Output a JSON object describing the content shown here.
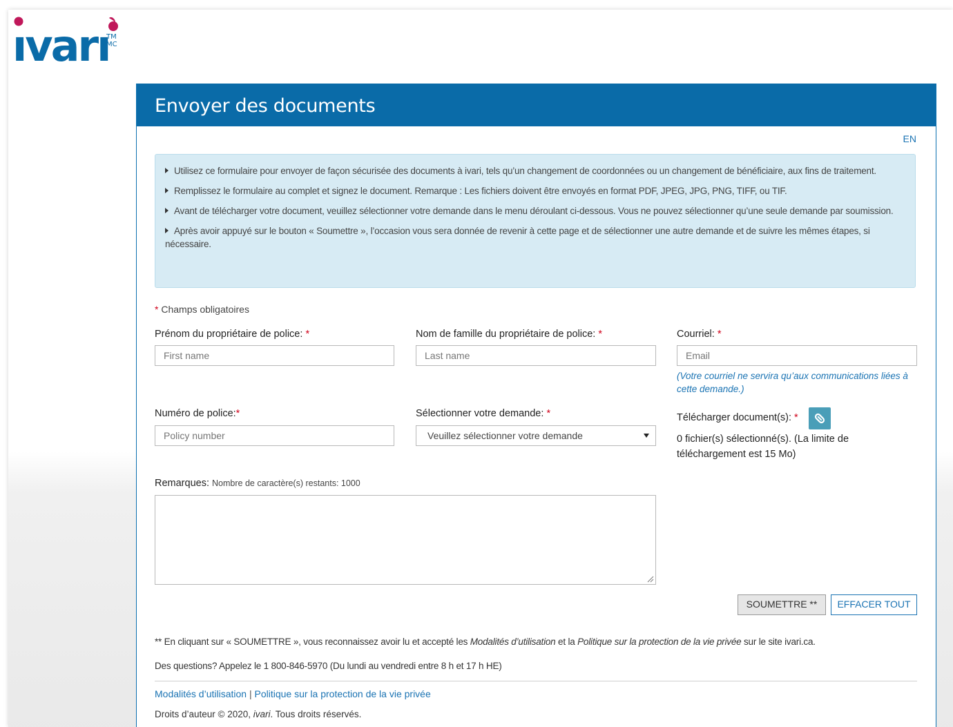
{
  "brand": {
    "logo_text": "ivari",
    "logo_mark": "TM MC",
    "logo_color": "#0a6ba8",
    "accent_color": "#c0185a"
  },
  "header": {
    "title": "Envoyer des documents",
    "lang_link": "EN"
  },
  "info": {
    "items": [
      "Utilisez ce formulaire pour envoyer de façon sécurisée des documents à ivari, tels qu’un changement de coordonnées ou un changement de bénéficiaire, aux fins de traitement.",
      "Remplissez le formulaire au complet et signez le document. Remarque : Les fichiers doivent être envoyés en format PDF, JPEG, JPG, PNG, TIFF, ou TIF.",
      "Avant de télécharger votre document, veuillez sélectionner votre demande dans le menu déroulant ci-dessous. Vous ne pouvez sélectionner qu’une seule demande par soumission.",
      "Après avoir appuyé sur le bouton « Soumettre », l’occasion vous sera donnée de revenir à cette page et de sélectionner une autre demande et de suivre les mêmes étapes, si nécessaire."
    ]
  },
  "form": {
    "required_marker": "*",
    "required_note": "Champs obligatoires",
    "first_name": {
      "label": "Prénom du propriétaire de police:",
      "placeholder": "First name",
      "value": ""
    },
    "last_name": {
      "label": "Nom de famille du propriétaire de police:",
      "placeholder": "Last name",
      "value": ""
    },
    "email": {
      "label": "Courriel:",
      "placeholder": "Email",
      "value": "",
      "hint": "(Votre courriel ne servira qu’aux communications liées à cette demande.)"
    },
    "policy": {
      "label": "Numéro de police:",
      "placeholder": "Policy number",
      "value": ""
    },
    "request": {
      "label": "Sélectionner votre demande:",
      "selected": "Veuillez sélectionner votre demande"
    },
    "upload": {
      "label": "Télécharger document(s):",
      "status": "0 fichier(s) sélectionné(s). (La limite de téléchargement est 15 Mo)",
      "icon": "paperclip-icon"
    },
    "remarks": {
      "label": "Remarques:",
      "counter": "Nombre de caractère(s) restants: 1000",
      "value": ""
    },
    "submit_label": "SOUMETTRE **",
    "clear_label": "EFFACER TOUT"
  },
  "footer": {
    "note_prefix": "** En cliquant sur « SOUMETTRE », vous reconnaissez avoir lu et accepté les ",
    "note_terms": "Modalités d’utilisation",
    "note_mid": " et la ",
    "note_privacy": "Politique sur la protection de la vie privée",
    "note_suffix": " sur le site ivari.ca.",
    "phone": "Des questions? Appelez le 1 800-846-5970 (Du lundi au vendredi entre 8 h et 17 h HE)",
    "link_terms": "Modalités d’utilisation",
    "link_sep": "|",
    "link_privacy": "Politique sur la protection de la vie privée",
    "copyright_prefix": "Droits d’auteur © 2020, ",
    "copyright_brand": "ivari",
    "copyright_suffix": ". Tous droits réservés."
  }
}
